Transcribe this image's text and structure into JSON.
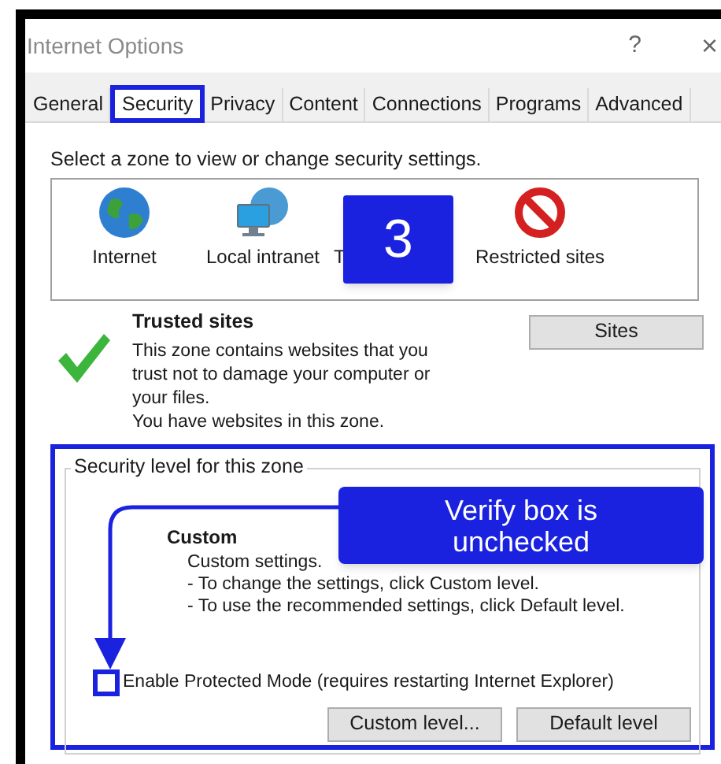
{
  "window": {
    "title": "Internet Options",
    "help": "?",
    "close": "×"
  },
  "tabs": [
    {
      "label": "General",
      "selected": false
    },
    {
      "label": "Security",
      "selected": true
    },
    {
      "label": "Privacy",
      "selected": false
    },
    {
      "label": "Content",
      "selected": false
    },
    {
      "label": "Connections",
      "selected": false
    },
    {
      "label": "Programs",
      "selected": false
    },
    {
      "label": "Advanced",
      "selected": false
    }
  ],
  "zones_prompt": "Select a zone to view or change security settings.",
  "zones": [
    {
      "kind": "globe",
      "label": "Internet"
    },
    {
      "kind": "network",
      "label": "Local intranet"
    },
    {
      "kind": "trusted",
      "label": "T"
    },
    {
      "kind": "restricted",
      "label": "Restricted sites"
    }
  ],
  "zone_info": {
    "title": "Trusted sites",
    "description": "This zone contains websites that you\ntrust not to damage your computer or\nyour files.\nYou have websites in this zone.",
    "button": "Sites"
  },
  "security_level": {
    "legend": "Security level for this zone",
    "name": "Custom",
    "lines": [
      "Custom settings.",
      "- To change the settings, click Custom level.",
      "- To use the recommended settings, click Default level."
    ]
  },
  "protected_mode": {
    "label": "Enable Protected Mode (requires restarting Internet Explorer)",
    "checked": false
  },
  "buttons": [
    "Custom level...",
    "Default level"
  ],
  "annotations": {
    "step": "3",
    "callout": "Verify box is unchecked"
  }
}
